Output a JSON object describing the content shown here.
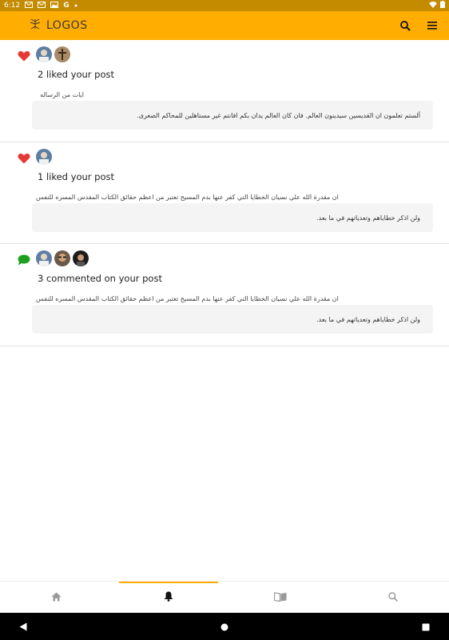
{
  "status_bar": {
    "time": "6:12",
    "left_icons": [
      "mail-icon",
      "mail-icon",
      "image-icon",
      "google-icon",
      "dot-icon"
    ],
    "right_icons": [
      "wifi-icon",
      "battery-icon"
    ]
  },
  "app_bar": {
    "logo_text": "LOGOS",
    "brand_color": "#ffad00",
    "actions": [
      "search-icon",
      "menu-icon"
    ]
  },
  "notifications": [
    {
      "type": "like",
      "type_icon": "heart-icon",
      "type_color": "#e53935",
      "avatars": [
        "avatar-user-1",
        "avatar-user-2"
      ],
      "title": "2 liked your post",
      "subtitle": "ايات من الرساله",
      "quote": "ألستم تعلمون ان القديسين سيدينون العالم. فان كان العالم يدان بكم افانتم غير مستاهلين للمحاكم الصغرى."
    },
    {
      "type": "like",
      "type_icon": "heart-icon",
      "type_color": "#e53935",
      "avatars": [
        "avatar-user-1"
      ],
      "title": "1 liked your post",
      "subtitle": "ان مقدرة الله علي نسيان الخطايا التي كفر عنها بدم المسيح تعتبر من اعظم حقائق الكتاب المقدس المسره للنفس",
      "quote": "ولن اذكر خطاياهم وتعدياتهم في ما بعد."
    },
    {
      "type": "comment",
      "type_icon": "chat-bubble-icon",
      "type_color": "#1ea01e",
      "avatars": [
        "avatar-user-1",
        "avatar-user-3",
        "avatar-user-4"
      ],
      "title": "3 commented on your post",
      "subtitle": "ان مقدرة الله علي نسيان الخطايا التي كفر عنها بدم المسيح تعتبر من اعظم حقائق الكتاب المقدس المسره للنفس",
      "quote": "ولن اذكر خطاياهم وتعدياتهم في ما بعد."
    }
  ],
  "bottom_nav": {
    "items": [
      "home-icon",
      "notifications-bell-icon",
      "book-icon",
      "search-icon"
    ],
    "active_index": 1
  },
  "system_nav": [
    "back-icon",
    "home-circle-icon",
    "recents-icon"
  ]
}
